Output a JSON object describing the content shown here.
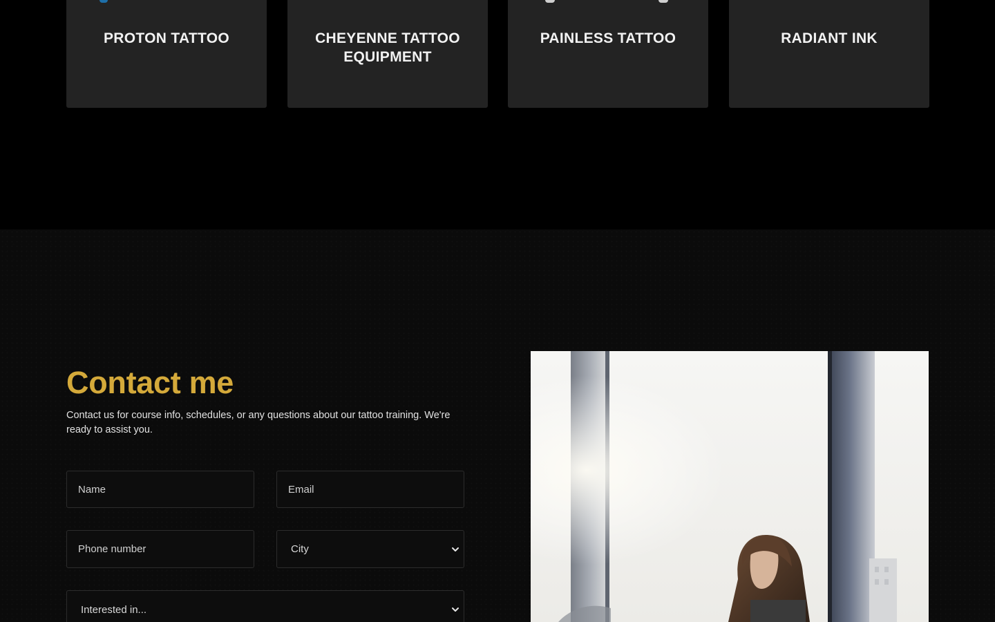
{
  "partners": [
    {
      "name": "PROTON TATTOO"
    },
    {
      "name": "CHEYENNE TATTOO EQUIPMENT"
    },
    {
      "name": "PAINLESS TATTOO"
    },
    {
      "name": "RADIANT INK"
    }
  ],
  "contact": {
    "title": "Contact me",
    "description": "Contact us for course info, schedules, or any questions about our tattoo training. We're ready to assist you.",
    "name_placeholder": "Name",
    "email_placeholder": "Email",
    "phone_placeholder": "Phone number",
    "city_selected": "City",
    "interest_selected": "Interested in..."
  },
  "colors": {
    "accent": "#d4a93a",
    "card_bg": "#232323",
    "page_bg": "#000000",
    "section_bg": "#0b0b0b"
  },
  "icons": {
    "select_arrow": "chevron-down-icon"
  }
}
